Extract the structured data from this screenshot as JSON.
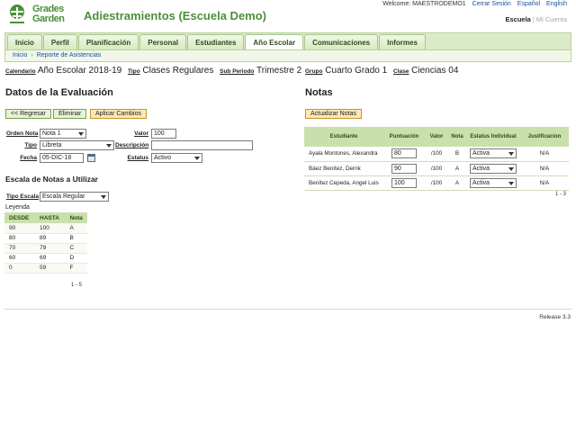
{
  "header": {
    "logo_line1": "Grades",
    "logo_line2": "Garden",
    "app_title": "Adiestramientos (Escuela Demo)",
    "welcome": "Welcome: MAESTRODEMO1",
    "logout": "Cerrar Sesión",
    "lang_es": "Español",
    "lang_en": "English",
    "view_school": "Escuela",
    "view_sep": "|",
    "view_mine": "Mi Cuenta"
  },
  "nav": {
    "tabs": [
      "Inicio",
      "Perfil",
      "Planificación",
      "Personal",
      "Estudiantes",
      "Año Escolar",
      "Comunicaciones",
      "Informes"
    ],
    "active_index": 5
  },
  "breadcrumb": {
    "home": "Inicio",
    "arrow": "›",
    "current": "Reporte de Asistencias"
  },
  "context": {
    "calendar_label": "Calendario",
    "calendar_value": "Año Escolar 2018-19",
    "type_label": "Tipo",
    "type_value": "Clases Regulares",
    "subperiod_label": "Sub Periodo",
    "subperiod_value": "Trimestre 2",
    "group_label": "Grupo",
    "group_value": "Cuarto Grado 1",
    "class_label": "Clase",
    "class_value": "Ciencias 04"
  },
  "evaluation": {
    "title": "Datos de la Evaluación",
    "back_btn": "<< Regresar",
    "delete_btn": "Eliminar",
    "apply_btn": "Aplicar Cambios",
    "order_label": "Orden Nota",
    "order_value": "Nota 1",
    "value_label": "Valor",
    "value_value": "100",
    "type_label": "Tipo",
    "type_value": "Libreta",
    "description_label": "Descripción",
    "description_value": "",
    "date_label": "Fecha",
    "date_value": "05-DIC-18",
    "status_label": "Estatus",
    "status_value": "Activo"
  },
  "scale": {
    "title": "Escala de Notas a Utilizar",
    "type_label": "Tipo Escala",
    "type_value": "Escala Regular",
    "legend_label": "Leyenda",
    "columns": [
      "DESDE",
      "HASTA",
      "Nota"
    ],
    "rows": [
      [
        "90",
        "100",
        "A"
      ],
      [
        "80",
        "89",
        "B"
      ],
      [
        "70",
        "79",
        "C"
      ],
      [
        "60",
        "69",
        "D"
      ],
      [
        "0",
        "59",
        "F"
      ]
    ],
    "pager": "1 - 5"
  },
  "notes": {
    "title": "Notas",
    "update_btn": "Actualizar Notas",
    "columns": [
      "Estudiante",
      "Puntuación",
      "Valor",
      "Nota",
      "Estatus Individual",
      "Justificacion"
    ],
    "rows": [
      {
        "student": "Ayala Montones, Alexandra",
        "score": "80",
        "value": "/100",
        "grade": "B",
        "status": "Activa",
        "justification": "N/A"
      },
      {
        "student": "Báez Benítez, Derrik",
        "score": "90",
        "value": "/100",
        "grade": "A",
        "status": "Activa",
        "justification": "N/A"
      },
      {
        "student": "Benítez Cepeda, Angel Luis",
        "score": "100",
        "value": "/100",
        "grade": "A",
        "status": "Activa",
        "justification": "N/A"
      }
    ],
    "pager": "1 - 3"
  },
  "footer": {
    "release": "Release 3.3"
  },
  "colors": {
    "brand_green": "#4b8f3a",
    "nav_bg": "#dcebc7",
    "table_header": "#c9e0ad",
    "orange_button": "#fbe8b5"
  }
}
